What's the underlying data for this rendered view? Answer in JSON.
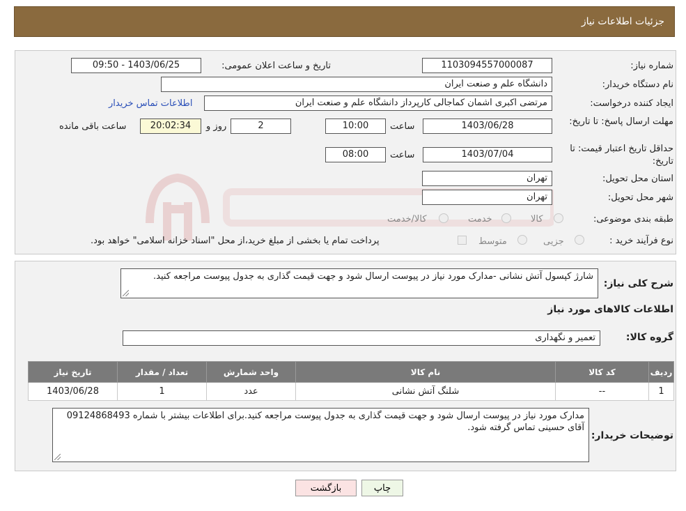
{
  "header": {
    "title": "جزئیات اطلاعات نیاز"
  },
  "form": {
    "need_number": {
      "label": "شماره نیاز:",
      "value": "1103094557000087"
    },
    "announce_datetime": {
      "label": "تاریخ و ساعت اعلان عمومی:",
      "value": "1403/06/25 - 09:50"
    },
    "buyer_org": {
      "label": "نام دستگاه خریدار:",
      "value": "دانشگاه علم و صنعت ایران"
    },
    "requester": {
      "label": "ایجاد کننده درخواست:",
      "value": "مرتضی اکبری اشمان کماجالی کارپرداز دانشگاه علم و صنعت ایران"
    },
    "contact_link": "اطلاعات تماس خریدار",
    "reply_deadline": {
      "label": "مهلت ارسال پاسخ: تا تاریخ:",
      "date": "1403/06/28",
      "time_label": "ساعت",
      "time": "10:00",
      "days": "2",
      "days_label": "روز و",
      "remaining": "20:02:34",
      "remaining_label": "ساعت باقی مانده"
    },
    "price_validity": {
      "label": "حداقل تاریخ اعتبار قیمت: تا تاریخ:",
      "date": "1403/07/04",
      "time_label": "ساعت",
      "time": "08:00"
    },
    "delivery_province": {
      "label": "استان محل تحویل:",
      "value": "تهران"
    },
    "delivery_city": {
      "label": "شهر محل تحویل:",
      "value": "تهران"
    },
    "category": {
      "label": "طبقه بندی موضوعی:",
      "options": [
        "کالا",
        "خدمت",
        "کالا/خدمت"
      ]
    },
    "purchase_type": {
      "label": "نوع فرآیند خرید :",
      "options": [
        "جزیی",
        "متوسط"
      ],
      "note": "پرداخت تمام یا بخشی از مبلغ خرید،از محل \"اسناد خزانه اسلامی\" خواهد بود."
    }
  },
  "details": {
    "general_desc_label": "شرح کلی نیاز:",
    "general_desc": "شارژ کپسول آتش نشانی -مدارک مورد نیاز در پیوست ارسال شود و جهت قیمت گذاری به جدول پیوست مراجعه کنید.",
    "goods_info_title": "اطلاعات کالاهای مورد نیاز",
    "goods_group_label": "گروه کالا:",
    "goods_group": "تعمیر و نگهداری",
    "table": {
      "headers": [
        "ردیف",
        "کد کالا",
        "نام کالا",
        "واحد شمارش",
        "تعداد / مقدار",
        "تاریخ نیاز"
      ],
      "rows": [
        [
          "1",
          "--",
          "شلنگ آتش نشانی",
          "عدد",
          "1",
          "1403/06/28"
        ]
      ]
    },
    "buyer_notes_label": "توضیحات خریدار:",
    "buyer_notes": "مدارک مورد نیاز در پیوست ارسال شود و جهت قیمت گذاری به جدول پیوست مراجعه کنید.برای اطلاعات بیشتر با شماره 09124868493 آقای حسینی تماس گرفته شود."
  },
  "buttons": {
    "print": "چاپ",
    "back": "بازگشت"
  },
  "colors": {
    "header_bg": "#8a6a3e",
    "print_bg": "#eef7e6",
    "back_bg": "#fbe3e3",
    "link": "#2a4fb8"
  }
}
